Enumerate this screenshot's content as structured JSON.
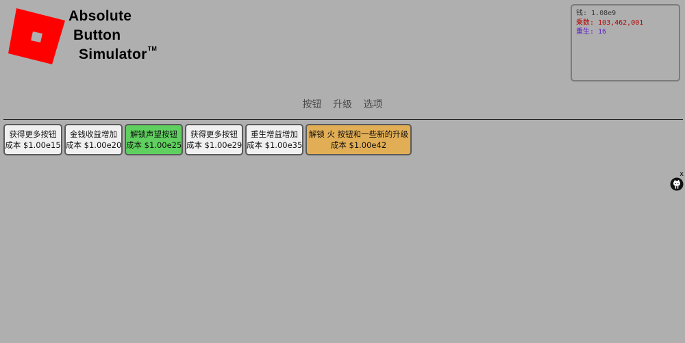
{
  "logo": {
    "line1": "Absolute",
    "line2": "Button",
    "line3": "Simulator",
    "tm": "TM",
    "square_color": "#ff0000"
  },
  "stats": {
    "money_label": "钱:",
    "money_value": "1.08e9",
    "multiplier_label": "乘数:",
    "multiplier_value": "103,462,001",
    "rebirth_label": "重生:",
    "rebirth_value": "16",
    "colors": {
      "money": "#3a3a3a",
      "multiplier": "#b10000",
      "rebirth": "#5a18c9"
    }
  },
  "nav": {
    "tabs": [
      {
        "label": "按钮"
      },
      {
        "label": "升级"
      },
      {
        "label": "选项"
      }
    ]
  },
  "upgrades": [
    {
      "title": "获得更多按钮",
      "cost": "成本 $1.00e15",
      "color": "#f0f0f0"
    },
    {
      "title": "金钱收益增加",
      "cost": "成本 $1.00e20",
      "color": "#f0f0f0"
    },
    {
      "title": "解锁声望按钮",
      "cost": "成本 $1.00e25",
      "color": "#5fd05f"
    },
    {
      "title": "获得更多按钮",
      "cost": "成本 $1.00e29",
      "color": "#f0f0f0"
    },
    {
      "title": "重生增益增加",
      "cost": "成本 $1.00e35",
      "color": "#f0f0f0"
    },
    {
      "title": "解锁 火 按钮和一些新的升级",
      "cost": "成本 $1.00e42",
      "color": "#e2ae55"
    }
  ],
  "helper": {
    "close_label": "x",
    "icon": "github-cat-icon"
  }
}
